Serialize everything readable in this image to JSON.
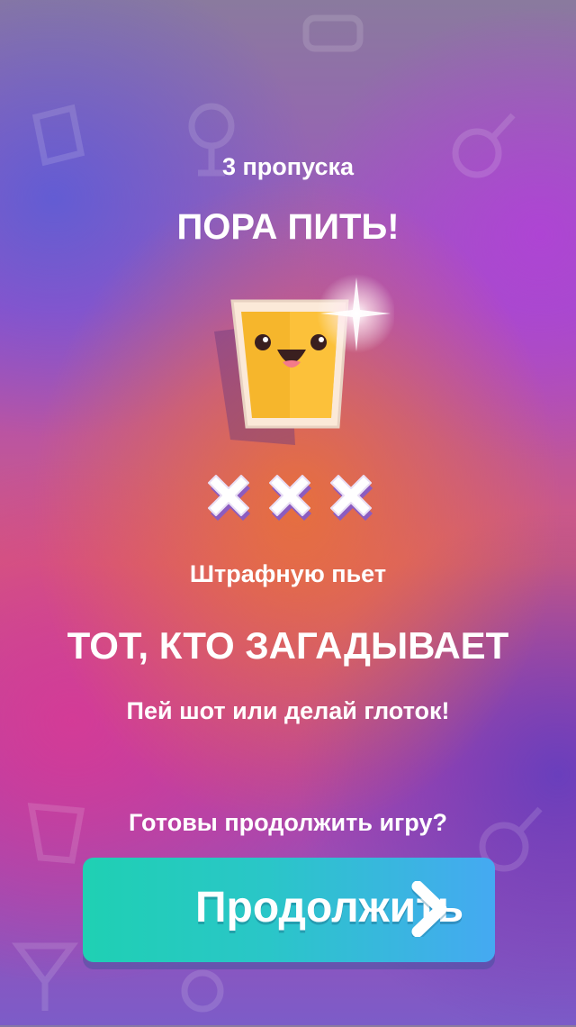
{
  "screen": {
    "skips_text": "3 пропуска",
    "title": "ПОРА ПИТЬ!",
    "penalty_label": "Штрафную пьет",
    "penalty_who": "ТОТ, КТО ЗАГАДЫВАЕТ",
    "instruction": "Пей шот или делай глоток!",
    "continue_prompt": "Готовы продолжить игру?",
    "skip_count": 3
  },
  "continue_button": {
    "label": "Продолжить",
    "icon": "chevron-right-icon"
  },
  "icons": {
    "mascot": "smiling-glass-icon",
    "strike": "x-mark-icon",
    "sparkle": "sparkle-icon",
    "background": "drink-doodle-icons"
  },
  "colors": {
    "button_start": "#1fd0b3",
    "button_end": "#45a9f2",
    "glass_fill": "#f6b62c",
    "x_mark": "#ffffff",
    "x_shadow": "#8c5cc0"
  }
}
